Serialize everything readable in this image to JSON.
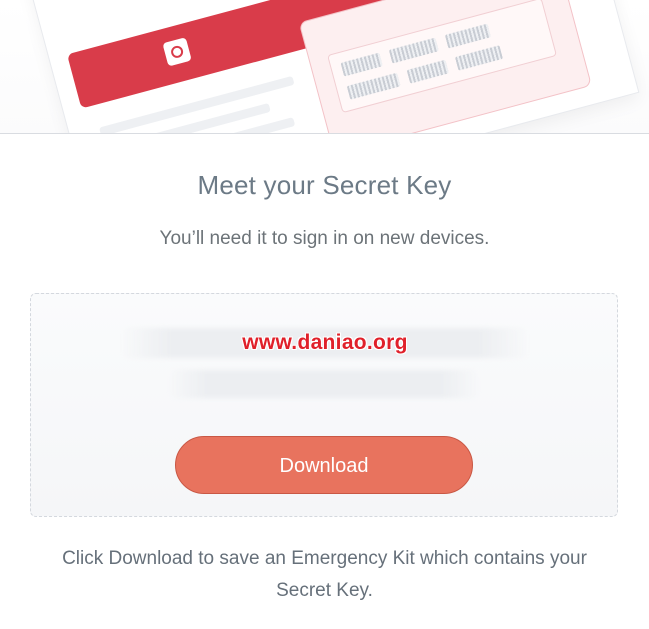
{
  "hero": {
    "illustration": "emergency-kit-document"
  },
  "title": "Meet your Secret Key",
  "subtitle": "You’ll need it to sign in on new devices.",
  "key_panel": {
    "watermark": "www.daniao.org"
  },
  "download_button": {
    "label": "Download",
    "color": "#e8735e"
  },
  "footnote": {
    "line1": "Click Download to save an Emergency Kit which contains your",
    "line2": "Secret Key."
  },
  "colors": {
    "title": "#6c7a86",
    "kit_header": "#d93c4a",
    "watermark": "#e0202a"
  }
}
